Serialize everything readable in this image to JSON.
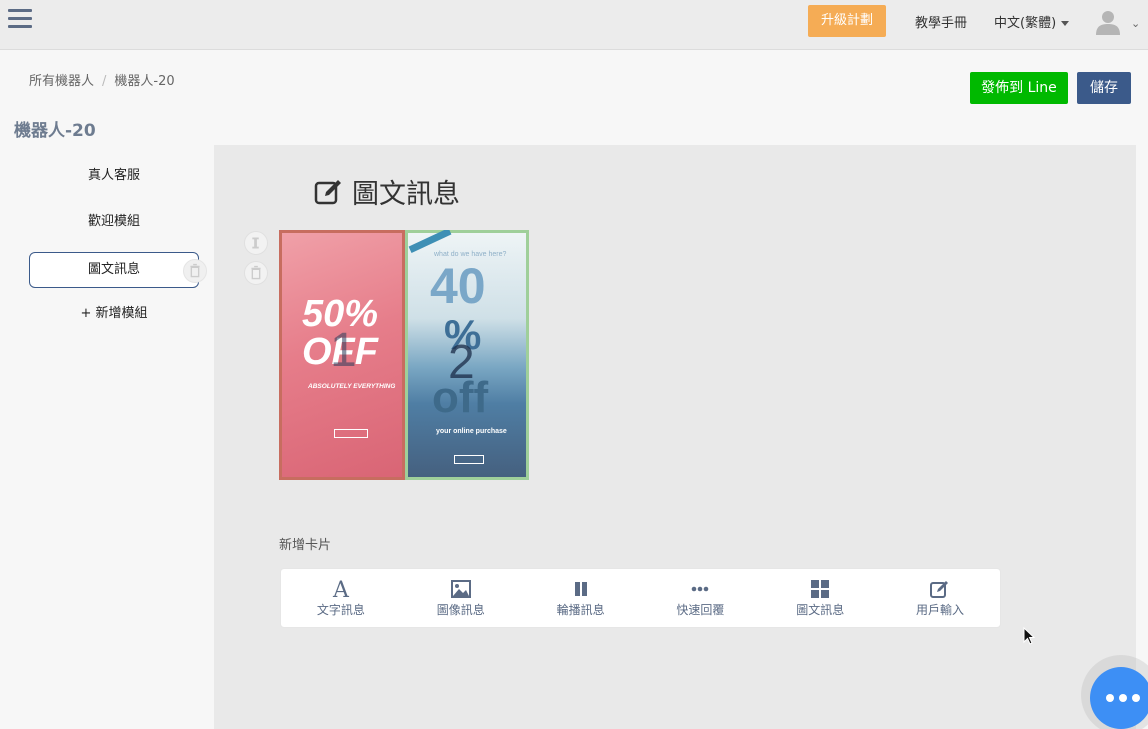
{
  "topbar": {
    "upgrade_label": "升級計劃",
    "manual_label": "教學手冊",
    "language_label": "中文(繁體)"
  },
  "breadcrumb": {
    "root": "所有機器人",
    "current": "機器人-20"
  },
  "header": {
    "bot_title": "機器人-20",
    "publish_label": "發佈到 Line",
    "save_label": "儲存"
  },
  "sidebar": {
    "items": [
      {
        "label": "真人客服"
      },
      {
        "label": "歡迎模組"
      },
      {
        "label": "圖文訊息"
      },
      {
        "label": "+ 新增模組"
      }
    ]
  },
  "main": {
    "title": "圖文訊息",
    "imagemap": {
      "left_headline": "50% OFF",
      "left_number": "1",
      "left_sub": "ABSOLUTELY EVERYTHING",
      "right_question": "what do we have here?",
      "right_big": "40",
      "right_pct": "%",
      "right_number": "2",
      "right_off": "off",
      "right_line": "your online purchase"
    },
    "add_card_label": "新增卡片",
    "tools": [
      {
        "label": "文字訊息",
        "icon": "text-icon"
      },
      {
        "label": "圖像訊息",
        "icon": "image-icon"
      },
      {
        "label": "輪播訊息",
        "icon": "carousel-icon"
      },
      {
        "label": "快速回覆",
        "icon": "quick-reply-icon"
      },
      {
        "label": "圖文訊息",
        "icon": "grid-icon"
      },
      {
        "label": "用戶輸入",
        "icon": "edit-icon"
      }
    ]
  },
  "colors": {
    "line_green": "#00b900",
    "save_blue": "#3b5a8a",
    "upgrade_orange": "#f5ac55",
    "chat_blue": "#3d8ff5"
  }
}
